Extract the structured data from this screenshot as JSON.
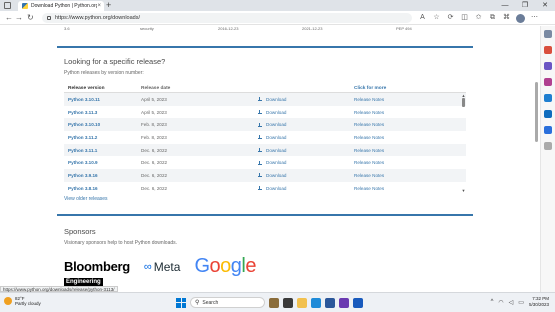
{
  "browser": {
    "tab_title": "Download Python | Python.org",
    "tab_close": "×",
    "new_tab": "+",
    "url": "https://www.python.org/downloads/",
    "window_controls": [
      "—",
      "❐",
      "✕"
    ]
  },
  "page": {
    "prev_row": [
      "3.6",
      "security",
      "2016-12-23",
      "2021-12-23",
      "PEP 494"
    ],
    "section_title": "Looking for a specific release?",
    "section_subtitle": "Python releases by version number:",
    "table": {
      "headers": [
        "Release version",
        "Release date",
        "",
        "Click for more"
      ],
      "rows": [
        {
          "version": "Python 3.10.11",
          "date": "April 5, 2023",
          "download": "Download",
          "notes": "Release Notes"
        },
        {
          "version": "Python 3.11.3",
          "date": "April 5, 2023",
          "download": "Download",
          "notes": "Release Notes"
        },
        {
          "version": "Python 3.10.10",
          "date": "Feb. 8, 2023",
          "download": "Download",
          "notes": "Release Notes"
        },
        {
          "version": "Python 3.11.2",
          "date": "Feb. 8, 2023",
          "download": "Download",
          "notes": "Release Notes"
        },
        {
          "version": "Python 3.11.1",
          "date": "Dec. 6, 2022",
          "download": "Download",
          "notes": "Release Notes"
        },
        {
          "version": "Python 3.10.9",
          "date": "Dec. 6, 2022",
          "download": "Download",
          "notes": "Release Notes"
        },
        {
          "version": "Python 3.9.16",
          "date": "Dec. 6, 2022",
          "download": "Download",
          "notes": "Release Notes"
        },
        {
          "version": "Python 3.8.16",
          "date": "Dec. 6, 2022",
          "download": "Download",
          "notes": "Release Notes"
        }
      ]
    },
    "older_link": "View older releases",
    "sponsors_title": "Sponsors",
    "sponsors_subtitle": "Visionary sponsors help to host Python downloads.",
    "sponsor_bloomberg": "Bloomberg",
    "sponsor_meta": "Meta",
    "sponsor_engineering": "Engineering"
  },
  "status_url": "https://www.python.org/downloads/release/python-3113/",
  "taskbar": {
    "weather_temp": "82°F",
    "weather_desc": "Partly cloudy",
    "search_label": "Search",
    "time": "7:32 PM",
    "date": "5/30/2023"
  },
  "colors": {
    "python_blue": "#3776ab",
    "accent": "#0078d4"
  }
}
